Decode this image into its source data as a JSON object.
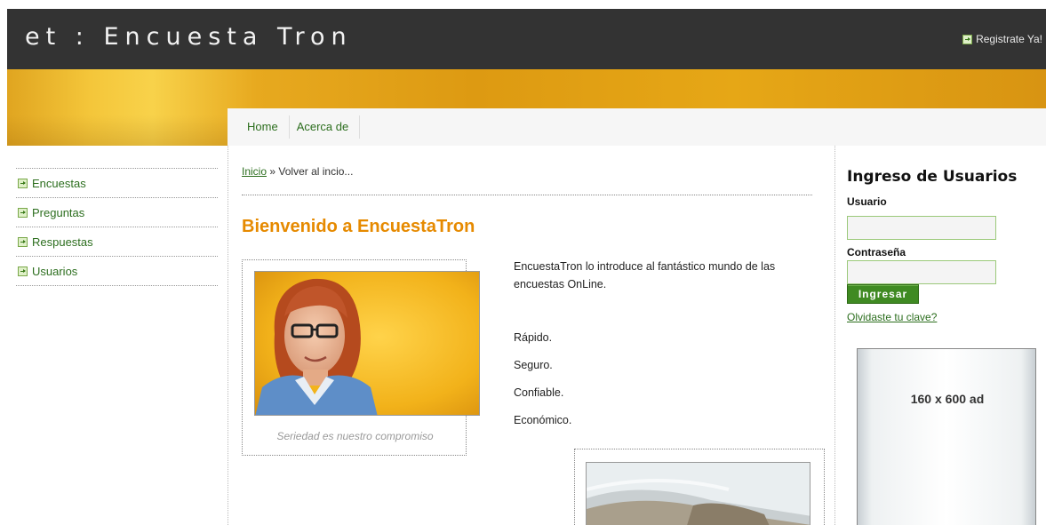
{
  "header": {
    "site_title": "et : Encuesta Tron",
    "register_label": "Registrate Ya!"
  },
  "nav": {
    "items": [
      "Home",
      "Acerca de"
    ]
  },
  "sidebar": {
    "items": [
      {
        "label": "Encuestas"
      },
      {
        "label": "Preguntas"
      },
      {
        "label": "Respuestas"
      },
      {
        "label": "Usuarios"
      }
    ]
  },
  "breadcrumb": {
    "link": "Inicio",
    "separator": "»",
    "text": "Volver al incio..."
  },
  "main": {
    "welcome_title": "Bienvenido a EncuestaTron",
    "photo_caption": "Seriedad es nuestro compromiso",
    "intro": "EncuestaTron lo introduce al fantástico mundo de las encuestas OnLine.",
    "features": [
      "Rápido.",
      "Seguro.",
      "Confiable.",
      "Económico."
    ]
  },
  "login": {
    "title": "Ingreso de Usuarios",
    "user_label": "Usuario",
    "user_value": "",
    "password_label": "Contraseña",
    "password_value": "",
    "submit_label": "Ingresar",
    "forgot_label": "Olvidaste tu clave?"
  },
  "ad": {
    "text": "160 x 600 ad"
  },
  "colors": {
    "header_bg": "#333333",
    "accent_orange": "#e68a00",
    "link_green": "#2c6e1e",
    "button_green": "#3f8a22",
    "band_gold": "#e7a91f"
  },
  "icons": {
    "list_bullet": "arrow-box-icon",
    "register": "arrow-box-icon"
  }
}
